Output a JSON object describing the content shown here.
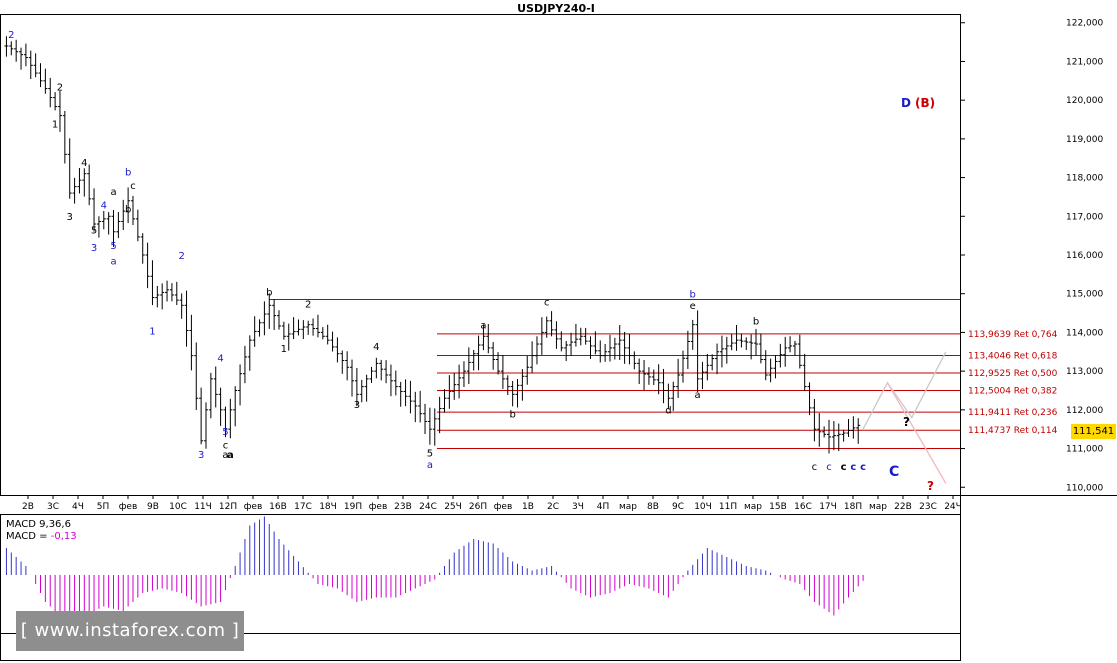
{
  "title": "USDJPY240-I",
  "current_price": "111,541",
  "watermark": "[ www.instaforex.com ]",
  "macd": {
    "line1": "MACD 9,36,6",
    "line2_label": "MACD = ",
    "line2_value": "-0,13",
    "value_color": "#d000d0"
  },
  "colors": {
    "fib": "#c00000",
    "blue": "#1a1acc",
    "red": "#cc0000",
    "macd_pos": "#3333cc",
    "macd_neg": "#d000d0",
    "projection": "#e89aa0"
  },
  "price_axis": [
    "122,000",
    "121,000",
    "120,000",
    "119,000",
    "118,000",
    "117,000",
    "116,000",
    "115,000",
    "114,000",
    "113,000",
    "112,000",
    "111,000",
    "110,000"
  ],
  "time_axis": [
    "2В",
    "3С",
    "4Ч",
    "5П",
    "фев",
    "9В",
    "10С",
    "11Ч",
    "12П",
    "фев",
    "16В",
    "17С",
    "18Ч",
    "19П",
    "фев",
    "23В",
    "24С",
    "25Ч",
    "26П",
    "фев",
    "1В",
    "2С",
    "3Ч",
    "4П",
    "мар",
    "8В",
    "9С",
    "10Ч",
    "11П",
    "мар",
    "15В",
    "16С",
    "17Ч",
    "18П",
    "мар",
    "22В",
    "23С",
    "24Ч"
  ],
  "fib_levels": [
    {
      "price": 113.9639,
      "label": "113,9639 Ret 0,764"
    },
    {
      "price": 113.4046,
      "label": "113,4046 Ret 0,618"
    },
    {
      "price": 112.9525,
      "label": "112,9525 Ret 0,500"
    },
    {
      "price": 112.5004,
      "label": "112,5004 Ret 0,382"
    },
    {
      "price": 111.9411,
      "label": "111,9411 Ret 0,236"
    },
    {
      "price": 111.4737,
      "label": "111,4737 Ret 0,114"
    },
    {
      "price": 111.0,
      "label": ""
    }
  ],
  "top_line_price": 114.85,
  "annotations": {
    "d_label": "D",
    "b_label": "(B)",
    "q1": "?",
    "q2": "?",
    "big_c": "C"
  },
  "wave_labels": [
    {
      "t": "2",
      "bar": 1,
      "p": 121.6,
      "c": "blue"
    },
    {
      "t": "2",
      "bar": 11,
      "p": 120.25,
      "c": "black"
    },
    {
      "t": "1",
      "bar": 10,
      "p": 119.3,
      "c": "black"
    },
    {
      "t": "4",
      "bar": 16,
      "p": 118.3,
      "c": "black"
    },
    {
      "t": "3",
      "bar": 13,
      "p": 116.9,
      "c": "black"
    },
    {
      "t": "a",
      "bar": 22,
      "p": 117.55,
      "c": "black"
    },
    {
      "t": "4",
      "bar": 20,
      "p": 117.2,
      "c": "blue"
    },
    {
      "t": "5",
      "bar": 18,
      "p": 116.55,
      "c": "black"
    },
    {
      "t": "3",
      "bar": 18,
      "p": 116.1,
      "c": "blue"
    },
    {
      "t": "5",
      "bar": 22,
      "p": 116.15,
      "c": "blue"
    },
    {
      "t": "a",
      "bar": 22,
      "p": 115.75,
      "c": "blue"
    },
    {
      "t": "b",
      "bar": 25,
      "p": 117.1,
      "c": "black"
    },
    {
      "t": "b",
      "bar": 25,
      "p": 118.05,
      "c": "blue"
    },
    {
      "t": "c",
      "bar": 26,
      "p": 117.7,
      "c": "black"
    },
    {
      "t": "2",
      "bar": 36,
      "p": 115.9,
      "c": "blue"
    },
    {
      "t": "1",
      "bar": 30,
      "p": 113.95,
      "c": "blue"
    },
    {
      "t": "4",
      "bar": 44,
      "p": 113.25,
      "c": "blue"
    },
    {
      "t": "5",
      "bar": 45,
      "p": 111.35,
      "c": "blue"
    },
    {
      "t": "c",
      "bar": 45,
      "p": 111.0,
      "c": "black"
    },
    {
      "t": "3",
      "bar": 40,
      "p": 110.75,
      "c": "blue"
    },
    {
      "t": "a",
      "bar": 45,
      "p": 110.75,
      "c": "black"
    },
    {
      "t": "b",
      "bar": 54,
      "p": 114.95,
      "c": "black"
    },
    {
      "t": "2",
      "bar": 62,
      "p": 114.65,
      "c": "black"
    },
    {
      "t": "1",
      "bar": 57,
      "p": 113.5,
      "c": "black"
    },
    {
      "t": "4",
      "bar": 76,
      "p": 113.55,
      "c": "black"
    },
    {
      "t": "3",
      "bar": 72,
      "p": 112.05,
      "c": "black"
    },
    {
      "t": "5",
      "bar": 87,
      "p": 110.8,
      "c": "black"
    },
    {
      "t": "a",
      "bar": 87,
      "p": 110.5,
      "c": "blue"
    },
    {
      "t": "a",
      "bar": 98,
      "p": 114.1,
      "c": "black"
    },
    {
      "t": "b",
      "bar": 104,
      "p": 111.8,
      "c": "black"
    },
    {
      "t": "c",
      "bar": 111,
      "p": 114.7,
      "c": "black"
    },
    {
      "t": "d",
      "bar": 136,
      "p": 111.9,
      "c": "black"
    },
    {
      "t": "b",
      "bar": 141,
      "p": 114.9,
      "c": "blue"
    },
    {
      "t": "e",
      "bar": 141,
      "p": 114.6,
      "c": "black"
    },
    {
      "t": "a",
      "bar": 142,
      "p": 112.3,
      "c": "black"
    },
    {
      "t": "b",
      "bar": 154,
      "p": 114.2,
      "c": "black"
    },
    {
      "t": "c",
      "bar": 166,
      "p": 110.45,
      "c": "black"
    },
    {
      "t": "c",
      "bar": 169,
      "p": 110.45,
      "c": "blue"
    }
  ],
  "bold_c_labels": [
    {
      "t": "c",
      "bar": 172,
      "p": 110.45,
      "c": "black"
    },
    {
      "t": "c",
      "bar": 174,
      "p": 110.45,
      "c": "blue"
    },
    {
      "t": "c",
      "bar": 176,
      "p": 110.45,
      "c": "blue"
    }
  ],
  "bold_a_labels": [
    {
      "t": "a",
      "bar": 46,
      "p": 110.75,
      "c": "black"
    }
  ],
  "chart_data": {
    "type": "candlestick",
    "title": "USDJPY240-I",
    "ylim": [
      109.8,
      122.2
    ],
    "y_ticks": [
      110,
      111,
      112,
      113,
      114,
      115,
      116,
      117,
      118,
      119,
      120,
      121,
      122
    ],
    "x_tick_labels": [
      "2В",
      "3С",
      "4Ч",
      "5П",
      "фев",
      "9В",
      "10С",
      "11Ч",
      "12П",
      "фев",
      "16В",
      "17С",
      "18Ч",
      "19П",
      "фев",
      "23В",
      "24С",
      "25Ч",
      "26П",
      "фев",
      "1В",
      "2С",
      "3Ч",
      "4П",
      "мар",
      "8В",
      "9С",
      "10Ч",
      "11П",
      "мар",
      "15В",
      "16С",
      "17Ч",
      "18П",
      "мар",
      "22В",
      "23С",
      "24Ч"
    ],
    "key_points": [
      {
        "bar": 0,
        "p": 121.4
      },
      {
        "bar": 4,
        "p": 121.1
      },
      {
        "bar": 8,
        "p": 120.3
      },
      {
        "bar": 11,
        "p": 119.6
      },
      {
        "bar": 13,
        "p": 117.6
      },
      {
        "bar": 16,
        "p": 118.1
      },
      {
        "bar": 18,
        "p": 116.8
      },
      {
        "bar": 21,
        "p": 117.0
      },
      {
        "bar": 22,
        "p": 116.6
      },
      {
        "bar": 25,
        "p": 117.4
      },
      {
        "bar": 28,
        "p": 116.0
      },
      {
        "bar": 30,
        "p": 114.9
      },
      {
        "bar": 33,
        "p": 115.1
      },
      {
        "bar": 36,
        "p": 114.7
      },
      {
        "bar": 38,
        "p": 113.4
      },
      {
        "bar": 40,
        "p": 111.2
      },
      {
        "bar": 42,
        "p": 112.8
      },
      {
        "bar": 44,
        "p": 112.0
      },
      {
        "bar": 45,
        "p": 111.5
      },
      {
        "bar": 47,
        "p": 112.5
      },
      {
        "bar": 50,
        "p": 113.8
      },
      {
        "bar": 54,
        "p": 114.7
      },
      {
        "bar": 57,
        "p": 113.9
      },
      {
        "bar": 62,
        "p": 114.2
      },
      {
        "bar": 66,
        "p": 113.8
      },
      {
        "bar": 70,
        "p": 113.1
      },
      {
        "bar": 72,
        "p": 112.4
      },
      {
        "bar": 76,
        "p": 113.2
      },
      {
        "bar": 80,
        "p": 112.6
      },
      {
        "bar": 84,
        "p": 112.1
      },
      {
        "bar": 87,
        "p": 111.5
      },
      {
        "bar": 90,
        "p": 112.3
      },
      {
        "bar": 94,
        "p": 113.0
      },
      {
        "bar": 98,
        "p": 113.9
      },
      {
        "bar": 101,
        "p": 113.0
      },
      {
        "bar": 104,
        "p": 112.4
      },
      {
        "bar": 107,
        "p": 113.1
      },
      {
        "bar": 111,
        "p": 114.3
      },
      {
        "bar": 114,
        "p": 113.6
      },
      {
        "bar": 118,
        "p": 113.9
      },
      {
        "bar": 122,
        "p": 113.4
      },
      {
        "bar": 126,
        "p": 113.8
      },
      {
        "bar": 130,
        "p": 113.0
      },
      {
        "bar": 134,
        "p": 112.7
      },
      {
        "bar": 136,
        "p": 112.3
      },
      {
        "bar": 138,
        "p": 112.9
      },
      {
        "bar": 141,
        "p": 114.2
      },
      {
        "bar": 142,
        "p": 112.8
      },
      {
        "bar": 146,
        "p": 113.5
      },
      {
        "bar": 150,
        "p": 113.8
      },
      {
        "bar": 154,
        "p": 113.7
      },
      {
        "bar": 156,
        "p": 112.9
      },
      {
        "bar": 160,
        "p": 113.6
      },
      {
        "bar": 162,
        "p": 113.7
      },
      {
        "bar": 164,
        "p": 112.6
      },
      {
        "bar": 166,
        "p": 111.5
      },
      {
        "bar": 169,
        "p": 111.3
      },
      {
        "bar": 172,
        "p": 111.4
      },
      {
        "bar": 175,
        "p": 111.6
      }
    ],
    "projection_path": [
      {
        "bar": 176,
        "p": 111.5
      },
      {
        "bar": 181,
        "p": 112.7
      },
      {
        "bar": 186,
        "p": 111.8
      },
      {
        "bar": 193,
        "p": 113.5
      }
    ],
    "projection_path2": [
      {
        "bar": 181,
        "p": 112.7
      },
      {
        "bar": 193,
        "p": 110.1
      }
    ],
    "macd_histogram_envelope": [
      {
        "bar": 0,
        "v": 0.6
      },
      {
        "bar": 4,
        "v": 0.2
      },
      {
        "bar": 8,
        "v": -0.6
      },
      {
        "bar": 12,
        "v": -1.0
      },
      {
        "bar": 16,
        "v": -0.9
      },
      {
        "bar": 20,
        "v": -0.7
      },
      {
        "bar": 24,
        "v": -0.8
      },
      {
        "bar": 28,
        "v": -0.4
      },
      {
        "bar": 32,
        "v": -0.3
      },
      {
        "bar": 36,
        "v": -0.4
      },
      {
        "bar": 40,
        "v": -0.7
      },
      {
        "bar": 44,
        "v": -0.6
      },
      {
        "bar": 47,
        "v": 0.2
      },
      {
        "bar": 50,
        "v": 1.1
      },
      {
        "bar": 53,
        "v": 1.3
      },
      {
        "bar": 56,
        "v": 0.8
      },
      {
        "bar": 60,
        "v": 0.3
      },
      {
        "bar": 64,
        "v": -0.2
      },
      {
        "bar": 68,
        "v": -0.3
      },
      {
        "bar": 72,
        "v": -0.6
      },
      {
        "bar": 76,
        "v": -0.5
      },
      {
        "bar": 80,
        "v": -0.5
      },
      {
        "bar": 84,
        "v": -0.3
      },
      {
        "bar": 88,
        "v": -0.1
      },
      {
        "bar": 92,
        "v": 0.5
      },
      {
        "bar": 96,
        "v": 0.8
      },
      {
        "bar": 100,
        "v": 0.7
      },
      {
        "bar": 104,
        "v": 0.3
      },
      {
        "bar": 108,
        "v": 0.1
      },
      {
        "bar": 112,
        "v": 0.2
      },
      {
        "bar": 116,
        "v": -0.3
      },
      {
        "bar": 120,
        "v": -0.5
      },
      {
        "bar": 124,
        "v": -0.4
      },
      {
        "bar": 128,
        "v": -0.2
      },
      {
        "bar": 132,
        "v": -0.3
      },
      {
        "bar": 136,
        "v": -0.5
      },
      {
        "bar": 140,
        "v": 0.1
      },
      {
        "bar": 144,
        "v": 0.6
      },
      {
        "bar": 148,
        "v": 0.4
      },
      {
        "bar": 152,
        "v": 0.2
      },
      {
        "bar": 156,
        "v": 0.1
      },
      {
        "bar": 160,
        "v": -0.1
      },
      {
        "bar": 163,
        "v": -0.2
      },
      {
        "bar": 166,
        "v": -0.6
      },
      {
        "bar": 170,
        "v": -0.9
      },
      {
        "bar": 173,
        "v": -0.5
      },
      {
        "bar": 176,
        "v": -0.13
      }
    ]
  }
}
